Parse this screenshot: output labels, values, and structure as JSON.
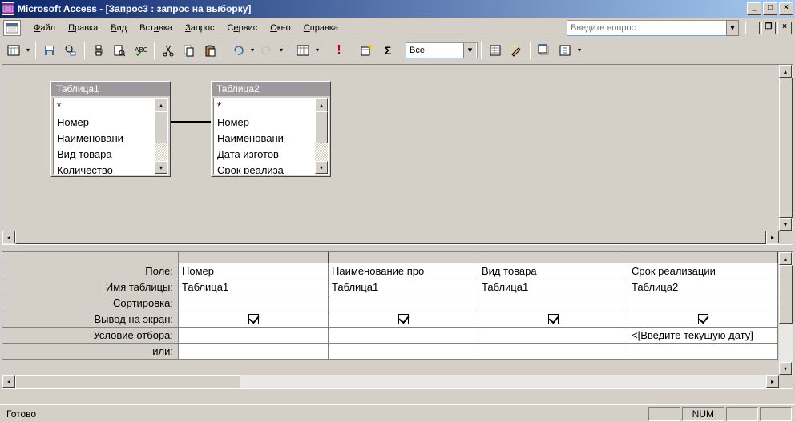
{
  "window": {
    "app_name": "Microsoft Access",
    "doc_title": "[Запрос3 : запрос на выборку]"
  },
  "menu": {
    "items": [
      "Файл",
      "Правка",
      "Вид",
      "Вставка",
      "Запрос",
      "Сервис",
      "Окно",
      "Справка"
    ],
    "help_placeholder": "Введите вопрос"
  },
  "toolbar": {
    "combo_value": "Все"
  },
  "design": {
    "table1": {
      "title": "Таблица1",
      "fields": [
        "*",
        "Номер",
        "Наименовани",
        "Вид товара",
        "Количество"
      ]
    },
    "table2": {
      "title": "Таблица2",
      "fields": [
        "*",
        "Номер",
        "Наименовани",
        "Дата изготов",
        "Срок реализа"
      ]
    }
  },
  "grid": {
    "row_labels": [
      "Поле:",
      "Имя таблицы:",
      "Сортировка:",
      "Вывод на экран:",
      "Условие отбора:",
      "или:"
    ],
    "columns": [
      {
        "field": "Номер",
        "table": "Таблица1",
        "sort": "",
        "show": true,
        "criteria": "",
        "or": ""
      },
      {
        "field": "Наименование про",
        "table": "Таблица1",
        "sort": "",
        "show": true,
        "criteria": "",
        "or": ""
      },
      {
        "field": "Вид товара",
        "table": "Таблица1",
        "sort": "",
        "show": true,
        "criteria": "",
        "or": ""
      },
      {
        "field": "Срок реализации",
        "table": "Таблица2",
        "sort": "",
        "show": true,
        "criteria": "<[Введите текущую дату]",
        "or": ""
      }
    ]
  },
  "status": {
    "text": "Готово",
    "indicator": "NUM"
  }
}
